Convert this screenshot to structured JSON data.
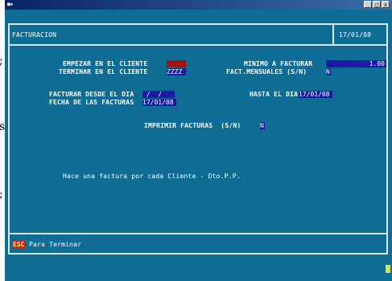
{
  "edge_glyphs": [
    ";",
    "s;",
    ";"
  ],
  "window": {
    "controls": [
      "_",
      "□",
      "x"
    ]
  },
  "header": {
    "title": "FACTURACION",
    "date": "17/01/08"
  },
  "form": {
    "start_client_label": "EMPEZAR EN EL CLIENTE",
    "start_client_value": "",
    "end_client_label": "TERMINAR EN EL CLIENTE",
    "end_client_value": "ZZZZ",
    "min_invoice_label": "MINIMO A FACTURAR",
    "min_invoice_value": "1.00",
    "monthly_label": "FACT.MENSUALES (S/N)",
    "monthly_value": "N",
    "from_day_label": "FACTURAR DESDE EL DIA",
    "from_day_value": " /  /",
    "to_day_label": "HASTA EL DIA",
    "to_day_value": "17/01/08",
    "invoice_date_label": "FECHA DE LAS FACTURAS",
    "invoice_date_value": "17/01/08",
    "print_label": "IMPRIMIR FACTURAS  (S/N)",
    "print_value": "N"
  },
  "info_text": "Hace una factura por cada Cliente - Dto.P.P.",
  "footer": {
    "esc_key": "ESC",
    "esc_label": "Para Terminar"
  },
  "colors": {
    "background": "#0f6c95",
    "field_red": "#a81010",
    "field_blue": "#1a1aa8",
    "frame": "#d8e8f0"
  }
}
